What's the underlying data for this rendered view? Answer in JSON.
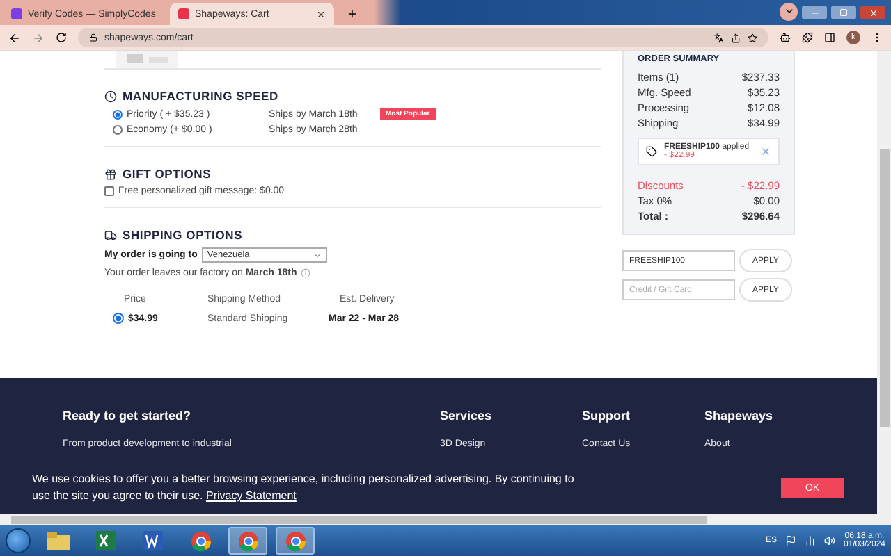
{
  "browser": {
    "tabs": [
      {
        "title": "Verify Codes — SimplyCodes",
        "selected": false,
        "kind": "simplycodes"
      },
      {
        "title": "Shapeways: Cart",
        "selected": true,
        "kind": "shapeways"
      }
    ],
    "address": "shapeways.com/cart",
    "profile": "k"
  },
  "manufacturing": {
    "title": "MANUFACTURING SPEED",
    "options": [
      {
        "label": "Priority ( + $35.23 )",
        "ships": "Ships by March 18th",
        "badge": "Most Popular",
        "selected": true
      },
      {
        "label": "Economy (+ $0.00 )",
        "ships": "Ships by March 28th",
        "selected": false
      }
    ]
  },
  "gift": {
    "title": "GIFT OPTIONS",
    "label": "Free personalized gift message: $0.00",
    "checked": false
  },
  "shipping": {
    "title": "SHIPPING OPTIONS",
    "going_label": "My order is going to",
    "country": "Venezuela",
    "leaves": "Your order leaves our factory on **March 18th**",
    "columns": [
      "Price",
      "Shipping Method",
      "Est. Delivery"
    ],
    "rows": [
      {
        "price": "$34.99",
        "method": "Standard Shipping",
        "delivery": "Mar 22 - Mar 28",
        "selected": true
      }
    ]
  },
  "summary": {
    "title": "ORDER SUMMARY",
    "lines": [
      {
        "label": "Items (1)",
        "value": "$237.33"
      },
      {
        "label": "Mfg. Speed",
        "value": "$35.23"
      },
      {
        "label": "Processing",
        "value": "$12.08"
      },
      {
        "label": "Shipping",
        "value": "$34.99"
      }
    ],
    "coupon": {
      "code": "FREESHIP100",
      "status": "applied",
      "amount": "- $22.99"
    },
    "totals": [
      {
        "label": "Discounts",
        "value": "- $22.99",
        "kind": "discount"
      },
      {
        "label": "Tax 0%",
        "value": "$0.00",
        "kind": "normal"
      },
      {
        "label": "Total :",
        "value": "$296.64",
        "kind": "total"
      }
    ],
    "promo_value": "FREESHIP100",
    "credit_placeholder": "Credit / Gift Card",
    "apply": [
      "APPLY",
      "APPLY"
    ]
  },
  "footer": {
    "intro_title": "Ready to get started?",
    "intro_text": "From product development to industrial",
    "columns": [
      {
        "title": "Services",
        "link": "3D Design"
      },
      {
        "title": "Support",
        "link": "Contact Us"
      },
      {
        "title": "Shapeways",
        "link": "About"
      }
    ]
  },
  "cookie": {
    "text": "We use cookies to offer you a better browsing experience, including personalized advertising. By continuing to use the site you agree to their use.",
    "link": "Privacy Statement",
    "button": "OK"
  },
  "taskbar": {
    "apps": [
      {
        "kind": "folder",
        "selected": false
      },
      {
        "kind": "excel",
        "selected": false
      },
      {
        "kind": "word",
        "selected": false
      },
      {
        "kind": "chrome",
        "selected": false
      },
      {
        "kind": "chrome",
        "selected": true
      },
      {
        "kind": "chrome",
        "selected": true
      }
    ],
    "language": "ES",
    "time": "06:18 a.m.",
    "date": "01/03/2024"
  }
}
